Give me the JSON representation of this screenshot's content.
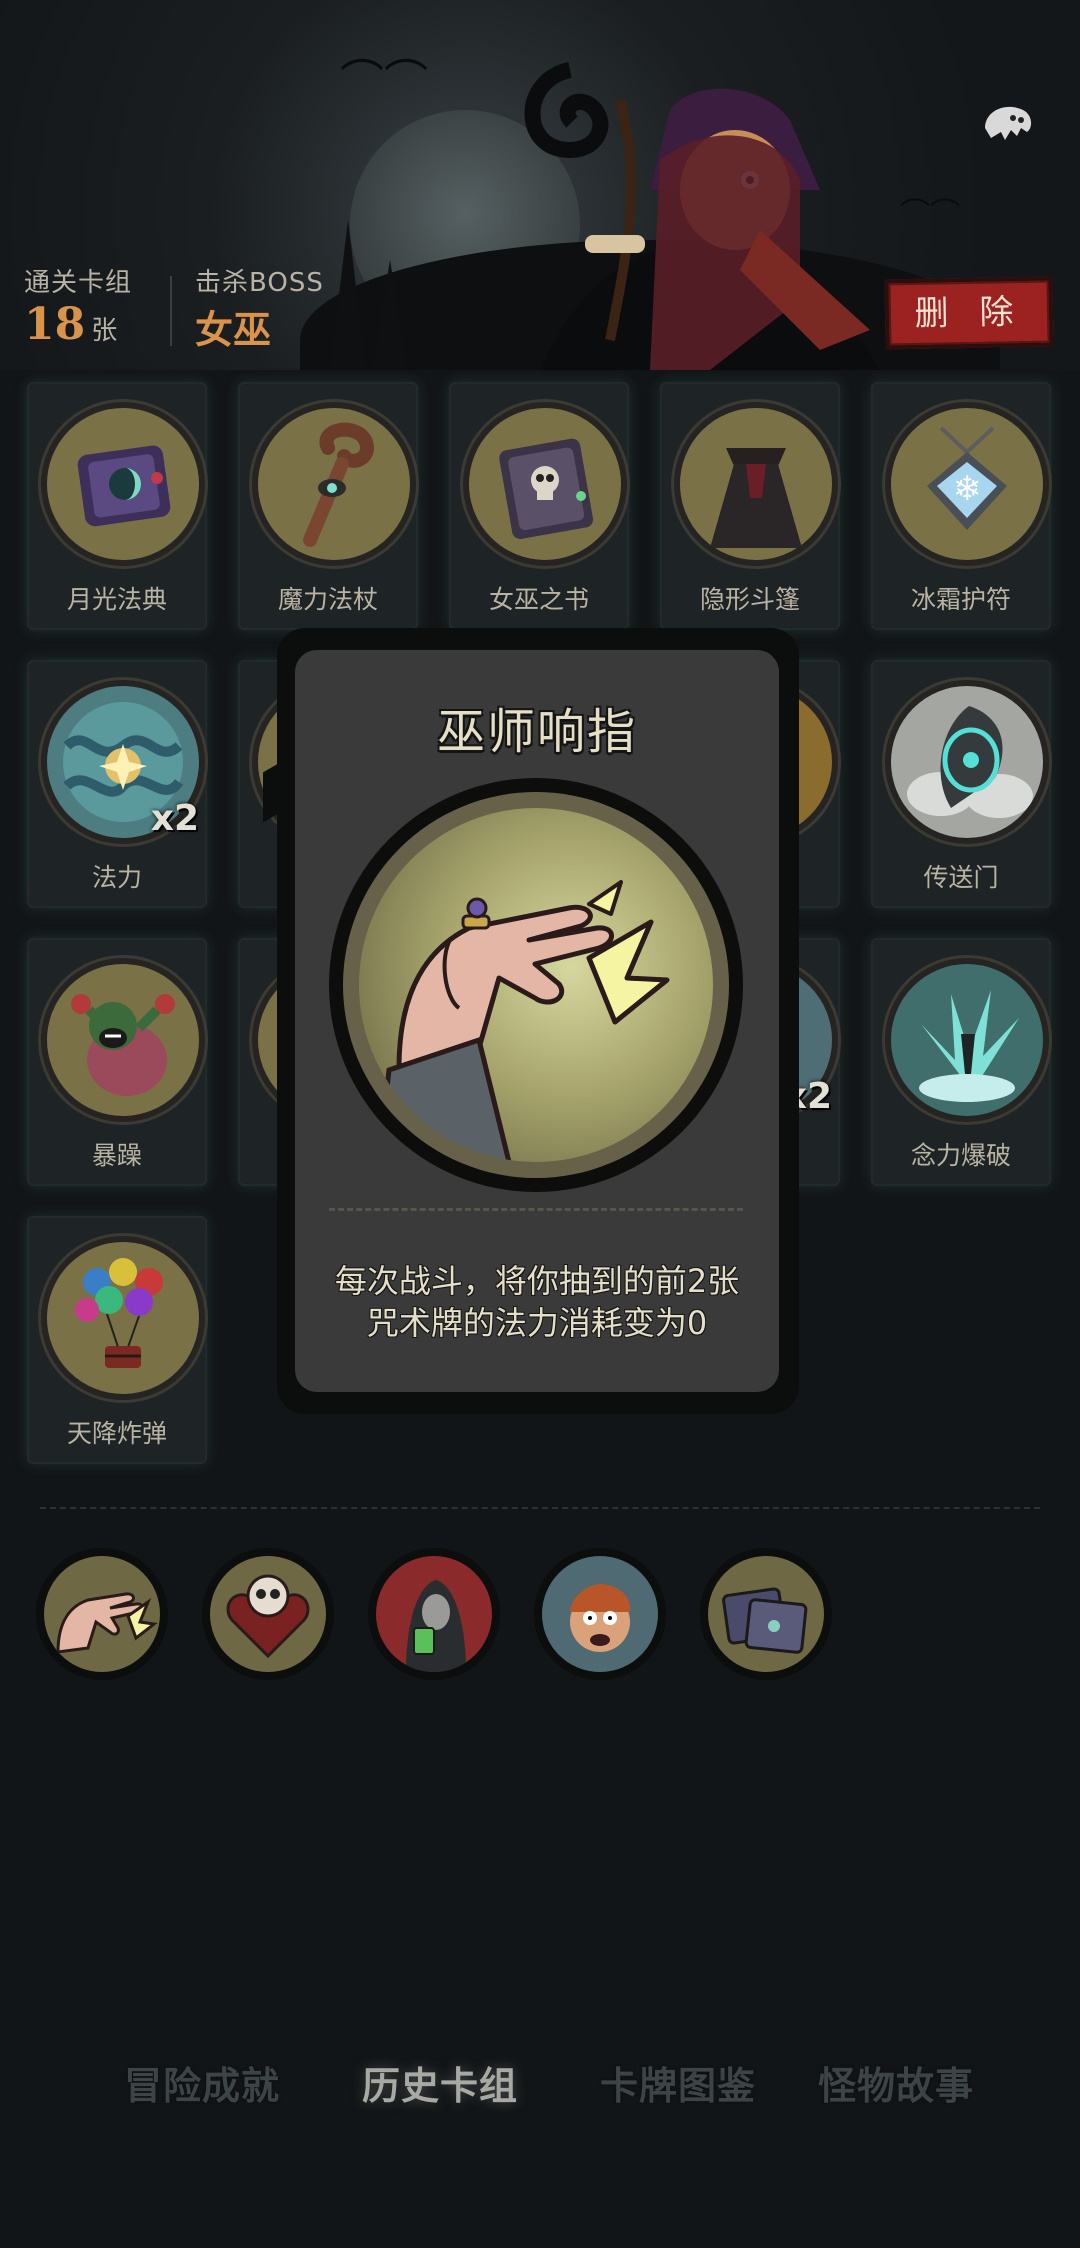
{
  "header": {
    "cleared_deck_label": "通关卡组",
    "cleared_deck_count": "18",
    "cleared_deck_unit": "张",
    "boss_label": "击杀BOSS",
    "boss_name": "女巫",
    "delete_label": "删 除",
    "ghost_icon": "ghost-icon"
  },
  "cards": [
    {
      "name": "月光法典",
      "icon": "moonlight-codex-icon",
      "count": ""
    },
    {
      "name": "魔力法杖",
      "icon": "magic-staff-icon",
      "count": ""
    },
    {
      "name": "女巫之书",
      "icon": "witch-book-icon",
      "count": ""
    },
    {
      "name": "隐形斗篷",
      "icon": "invisibility-cloak-icon",
      "count": ""
    },
    {
      "name": "冰霜护符",
      "icon": "frost-amulet-icon",
      "count": ""
    },
    {
      "name": "法力",
      "icon": "mana-icon",
      "count": "x2"
    },
    {
      "name": "传送门",
      "icon": "portal-icon",
      "count": ""
    },
    {
      "name": "暴躁",
      "icon": "rage-icon",
      "count": ""
    },
    {
      "name": "念力爆破",
      "icon": "telekinetic-blast-icon",
      "count": ""
    },
    {
      "name": "天降炸弹",
      "icon": "balloon-bomb-icon",
      "count": ""
    }
  ],
  "hidden_badge": "x2",
  "popup": {
    "title": "巫师响指",
    "icon": "finger-snap-icon",
    "description_line1": "每次战斗，将你抽到的前2张",
    "description_line2": "咒术牌的法力消耗变为0"
  },
  "relics": [
    {
      "icon": "finger-snap-icon"
    },
    {
      "icon": "skull-heart-icon"
    },
    {
      "icon": "hooded-figure-icon"
    },
    {
      "icon": "scared-man-icon"
    },
    {
      "icon": "card-stack-icon"
    }
  ],
  "tabs": [
    {
      "label": "冒险成就",
      "active": false
    },
    {
      "label": "历史卡组",
      "active": true
    },
    {
      "label": "卡牌图鉴",
      "active": false
    },
    {
      "label": "怪物故事",
      "active": false
    }
  ]
}
